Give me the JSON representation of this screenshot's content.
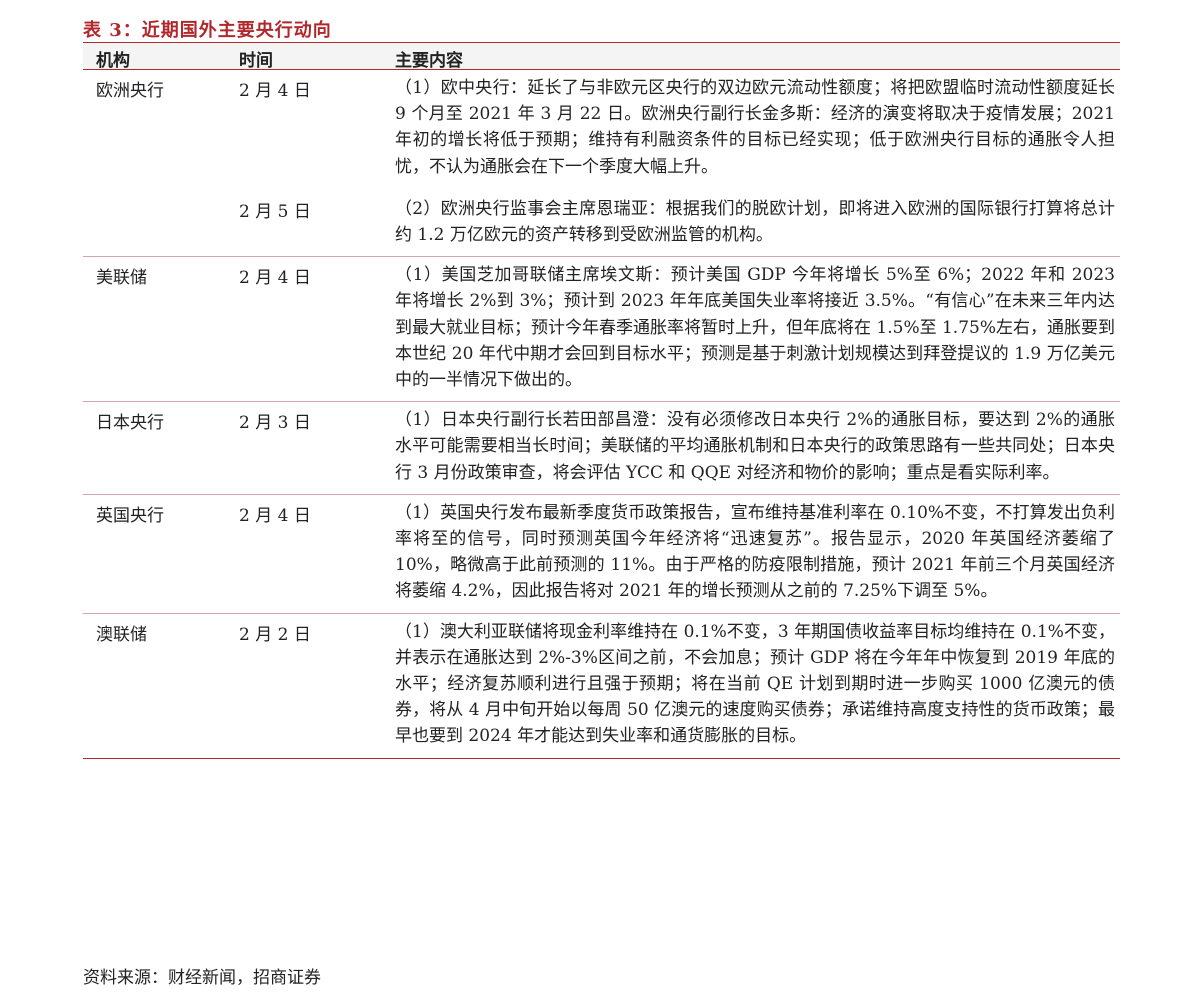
{
  "table_title": "表 3：近期国外主要央行动向",
  "headers": [
    "机构",
    "时间",
    "主要内容"
  ],
  "rows": [
    {
      "institution": "欧洲央行",
      "entries": [
        {
          "date": "2 月 4 日",
          "content": "（1）欧中央行：延长了与非欧元区央行的双边欧元流动性额度；将把欧盟临时流动性额度延长 9 个月至 2021 年 3 月 22 日。欧洲央行副行长金多斯：经济的演变将取决于疫情发展；2021 年初的增长将低于预期；维持有利融资条件的目标已经实现；低于欧洲央行目标的通胀令人担忧，不认为通胀会在下一个季度大幅上升。"
        },
        {
          "date": "2 月 5 日",
          "content": "（2）欧洲央行监事会主席恩瑞亚：根据我们的脱欧计划，即将进入欧洲的国际银行打算将总计约 1.2 万亿欧元的资产转移到受欧洲监管的机构。"
        }
      ]
    },
    {
      "institution": "美联储",
      "entries": [
        {
          "date": "2 月 4 日",
          "content": "（1）美国芝加哥联储主席埃文斯：预计美国 GDP 今年将增长 5%至 6%；2022 年和 2023 年将增长 2%到 3%；预计到 2023 年年底美国失业率将接近 3.5%。“有信心”在未来三年内达到最大就业目标；预计今年春季通胀率将暂时上升，但年底将在 1.5%至 1.75%左右，通胀要到本世纪 20 年代中期才会回到目标水平；预测是基于刺激计划规模达到拜登提议的 1.9 万亿美元中的一半情况下做出的。"
        }
      ]
    },
    {
      "institution": "日本央行",
      "entries": [
        {
          "date": "2 月 3 日",
          "content": "（1）日本央行副行长若田部昌澄：没有必须修改日本央行 2%的通胀目标，要达到 2%的通胀水平可能需要相当长时间；美联储的平均通胀机制和日本央行的政策思路有一些共同处；日本央行 3 月份政策审查，将会评估 YCC 和 QQE 对经济和物价的影响；重点是看实际利率。"
        }
      ]
    },
    {
      "institution": "英国央行",
      "entries": [
        {
          "date": "2 月 4 日",
          "content": "（1）英国央行发布最新季度货币政策报告，宣布维持基准利率在 0.10%不变，不打算发出负利率将至的信号，同时预测英国今年经济将“迅速复苏”。报告显示，2020 年英国经济萎缩了 10%，略微高于此前预测的 11%。由于严格的防疫限制措施，预计 2021 年前三个月英国经济将萎缩 4.2%，因此报告将对 2021 年的增长预测从之前的 7.25%下调至 5%。"
        }
      ]
    },
    {
      "institution": "澳联储",
      "entries": [
        {
          "date": "2 月 2 日",
          "content": "（1）澳大利亚联储将现金利率维持在 0.1%不变，3 年期国债收益率目标均维持在 0.1%不变，并表示在通胀达到 2%-3%区间之前，不会加息；预计 GDP 将在今年年中恢复到 2019 年底的水平；经济复苏顺利进行且强于预期；将在当前 QE 计划到期时进一步购买 1000 亿澳元的债券，将从 4 月中旬开始以每周 50 亿澳元的速度购买债券；承诺维持高度支持性的货币政策；最早也要到 2024 年才能达到失业率和通货膨胀的目标。"
        }
      ]
    }
  ],
  "source": "资料来源：财经新闻，招商证券"
}
